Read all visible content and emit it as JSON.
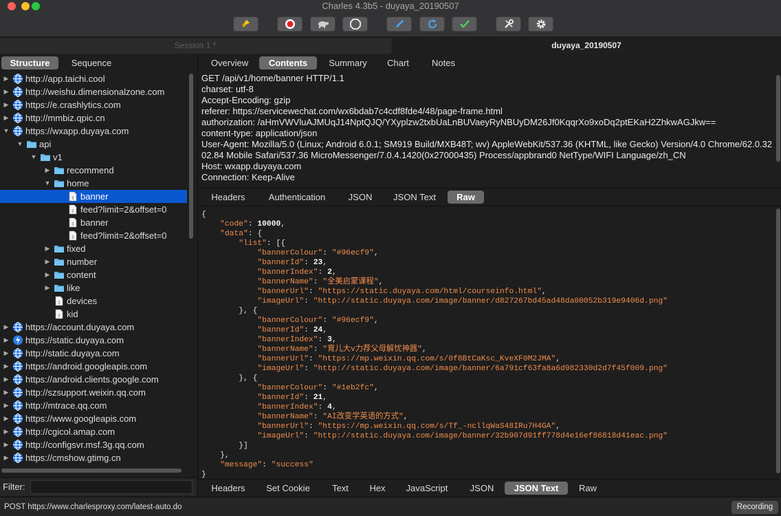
{
  "window": {
    "title": "Charles 4.3b5 - duyaya_20190507"
  },
  "toolbar": {
    "buttons": [
      "broom-icon",
      "record-icon",
      "turtle-icon",
      "stop-icon",
      "pen-icon",
      "refresh-icon",
      "check-icon",
      "tools-icon",
      "gear-icon"
    ]
  },
  "sessions": [
    "Session 1 *",
    "duyaya_20190507"
  ],
  "left_tabs": [
    "Structure",
    "Sequence"
  ],
  "tree": {
    "items": [
      "http://app.taichi.cool",
      "http://weishu.dimensionalzone.com",
      "https://e.crashlytics.com",
      "http://mmbiz.qpic.cn",
      "https://wxapp.duyaya.com",
      "api",
      "v1",
      "recommend",
      "home",
      "banner",
      "feed?limit=2&offset=0",
      "banner",
      "feed?limit=2&offset=0",
      "fixed",
      "number",
      "content",
      "like",
      "devices",
      "kid",
      "https://account.duyaya.com",
      "https://static.duyaya.com",
      "http://static.duyaya.com",
      "https://android.googleapis.com",
      "https://android.clients.google.com",
      "http://szsupport.weixin.qq.com",
      "http://mtrace.qq.com",
      "https://www.googleapis.com",
      "http://cgicol.amap.com",
      "http://configsvr.msf.3g.qq.com",
      "https://cmshow.gtimg.cn"
    ]
  },
  "filter": {
    "label": "Filter:",
    "value": ""
  },
  "top_tabs": [
    "Overview",
    "Contents",
    "Summary",
    "Chart",
    "Notes"
  ],
  "request": {
    "text": "GET /api/v1/home/banner HTTP/1.1\ncharset: utf-8\nAccept-Encoding: gzip\nreferer: https://servicewechat.com/wx6bdab7c4cdf8fde4/48/page-frame.html\nauthorization: /aHmVWVluAJMUqJ14NptQJQ/YXyplzw2txbUaLnBUVaeyRyNBUyDM26Jf0KqqrXo9xoDq2ptEKaH2ZhkwAGJkw==\ncontent-type: application/json\nUser-Agent: Mozilla/5.0 (Linux; Android 6.0.1; SM919 Build/MXB48T; wv) AppleWebKit/537.36 (KHTML, like Gecko) Version/4.0 Chrome/62.0.3202.84 Mobile Safari/537.36 MicroMessenger/7.0.4.1420(0x27000435) Process/appbrand0 NetType/WIFI Language/zh_CN\nHost: wxapp.duyaya.com\nConnection: Keep-Alive"
  },
  "mid_tabs": [
    "Headers",
    "Authentication",
    "JSON",
    "JSON Text",
    "Raw"
  ],
  "response": {
    "code": "10000",
    "message": "success",
    "list": [
      {
        "bannerColour": "#96ecf9",
        "bannerId": "23",
        "bannerIndex": "2",
        "bannerName": "全美启蒙课程",
        "bannerUrl": "https://static.duyaya.com/html/courseinfo.html",
        "imageUrl": "http://static.duyaya.com/image/banner/d827267bd45ad48da00052b319e9406d.png"
      },
      {
        "bannerColour": "#96ecf9",
        "bannerId": "24",
        "bannerIndex": "3",
        "bannerName": "育儿大v力荐父母解忧神器",
        "bannerUrl": "https://mp.weixin.qq.com/s/0f8BtCaKsc_KveXF0M2JMA",
        "imageUrl": "http://static.duyaya.com/image/banner/6a791cf63fa8a6d982330d2d7f45f009.png"
      },
      {
        "bannerColour": "#1eb2fc",
        "bannerId": "21",
        "bannerIndex": "4",
        "bannerName": "AI改变学英语的方式",
        "bannerUrl": "https://mp.weixin.qq.com/s/Tf_-ncllqWaS48IRu7H4GA",
        "imageUrl": "http://static.duyaya.com/image/banner/32b907d91ff778d4e16ef86818d41eac.png"
      }
    ]
  },
  "bottom_tabs": [
    "Headers",
    "Set Cookie",
    "Text",
    "Hex",
    "JavaScript",
    "JSON",
    "JSON Text",
    "Raw"
  ],
  "status": {
    "text": "POST https://www.charlesproxy.com/latest-auto.do",
    "recording": "Recording"
  },
  "colors": {
    "accent": "#0b57d0",
    "string": "#f08d4b",
    "background": "#1e1e1e"
  }
}
